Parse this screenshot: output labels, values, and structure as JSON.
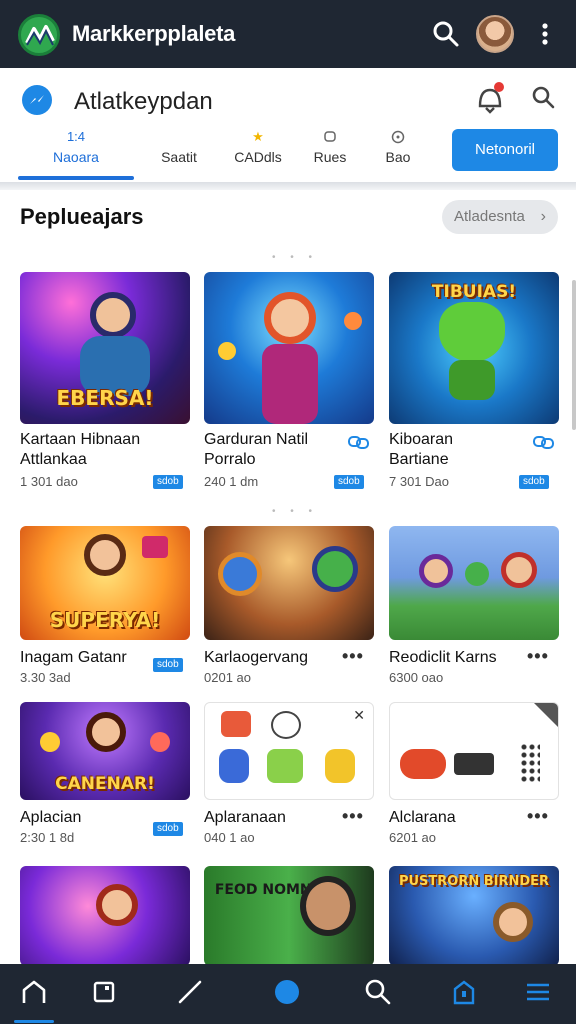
{
  "topbar": {
    "app_title": "Markkerpplaleta",
    "icons": [
      "app-logo-icon",
      "search-icon",
      "avatar",
      "more-vert-icon"
    ]
  },
  "header": {
    "title": "Atlatkeypdan",
    "cta_label": "Netonoril",
    "tabs": [
      {
        "top": "1:4",
        "label": "Naoara",
        "active": true
      },
      {
        "top": "",
        "label": "Saatit",
        "active": false
      },
      {
        "top": "★",
        "label": "CADdls",
        "active": false
      },
      {
        "top": "",
        "label": "Rues",
        "active": false
      },
      {
        "top": "",
        "label": "Bao",
        "active": false
      }
    ]
  },
  "section": {
    "title": "Peplueajars",
    "see_all_label": "Atladesnta",
    "cards": [
      {
        "name1": "Kartaan Hibnaan",
        "name2": "Attlankaa",
        "meta": "1 301 dao",
        "badge": "sdob",
        "action": "link",
        "art_text": "EBERSA!"
      },
      {
        "name1": "Garduran Natil",
        "name2": "Porralo",
        "meta": "240 1 dm",
        "badge": "sdob",
        "action": "link",
        "art_text": ""
      },
      {
        "name1": "Kiboaran",
        "name2": "Bartiane",
        "meta": "7 301 Dao",
        "badge": "sdob",
        "action": "link",
        "art_text": "TIBUIAS!"
      },
      {
        "name1": "Inagam Gatanr",
        "name2": "",
        "meta": "3.30 3ad",
        "badge": "sdob",
        "action": "none",
        "art_text": "SUPERYA!"
      },
      {
        "name1": "Karlaogervang",
        "name2": "",
        "meta": "0201 ao",
        "badge": "",
        "action": "more",
        "art_text": ""
      },
      {
        "name1": "Reodiclit Karns",
        "name2": "",
        "meta": "6300 oao",
        "badge": "",
        "action": "more",
        "art_text": ""
      },
      {
        "name1": "Aplacian",
        "name2": "",
        "meta": "2:30 1 8d",
        "badge": "sdob",
        "action": "none",
        "art_text": "CANENAR!"
      },
      {
        "name1": "Aplaranaan",
        "name2": "",
        "meta": "040 1 ao",
        "badge": "",
        "action": "more",
        "art_text": ""
      },
      {
        "name1": "Alclarana",
        "name2": "",
        "meta": "6201 ao",
        "badge": "",
        "action": "more",
        "art_text": ""
      },
      {
        "name1": "",
        "name2": "",
        "meta": "",
        "badge": "",
        "action": "none",
        "art_text": ""
      },
      {
        "name1": "",
        "name2": "",
        "meta": "",
        "badge": "",
        "action": "none",
        "art_text": "FEOD NOMNG"
      },
      {
        "name1": "",
        "name2": "",
        "meta": "",
        "badge": "",
        "action": "none",
        "art_text": "PUSTRORN BIRNDER"
      }
    ]
  },
  "bottom_nav": {
    "items": [
      "home-icon",
      "square-icon",
      "pen-icon",
      "circle-icon",
      "search-icon",
      "shield-icon",
      "menu-icon"
    ],
    "active_index": 0
  },
  "colors": {
    "accent": "#1e88e5",
    "topbar_bg": "#1f2733",
    "badge": "#1e88e5"
  }
}
